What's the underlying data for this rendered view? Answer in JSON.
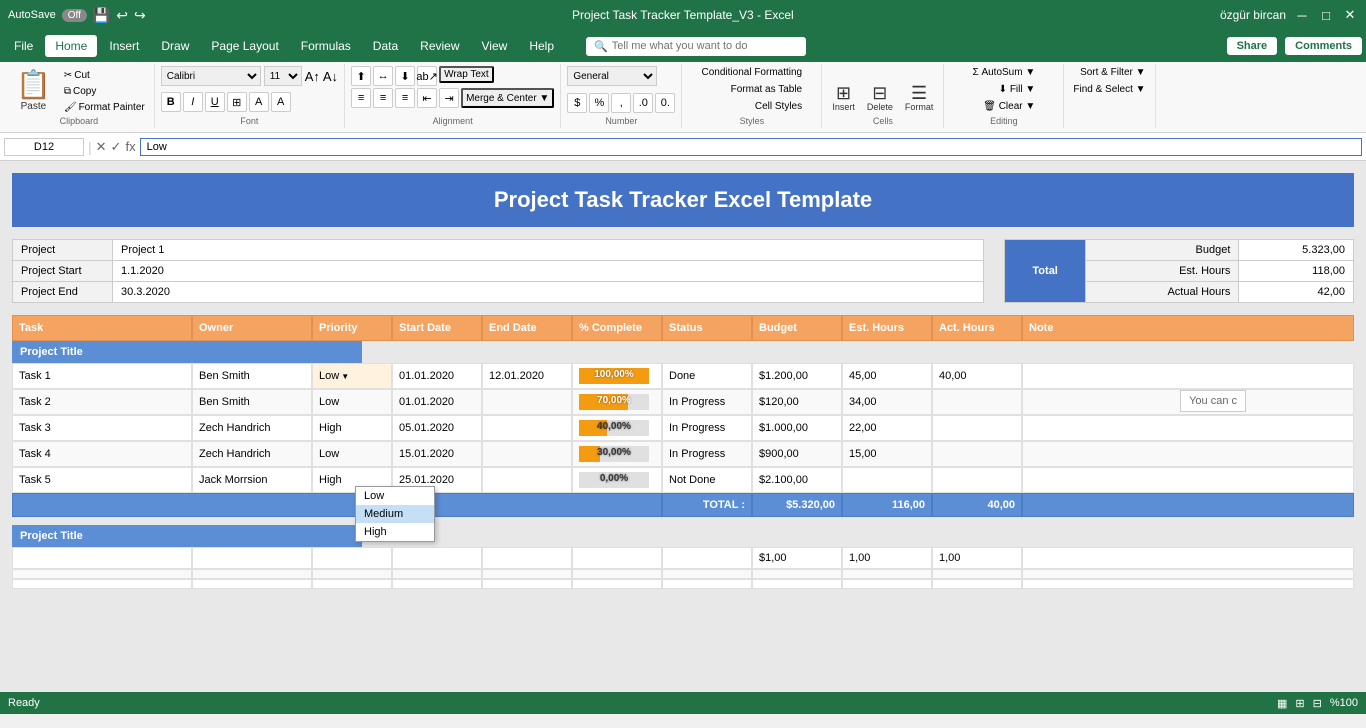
{
  "titleBar": {
    "autosave": "AutoSave",
    "autosave_off": "Off",
    "title": "Project Task Tracker Template_V3 - Excel",
    "user": "özgür bircan"
  },
  "menuBar": {
    "items": [
      "File",
      "Home",
      "Insert",
      "Draw",
      "Page Layout",
      "Formulas",
      "Data",
      "Review",
      "View",
      "Help"
    ],
    "active": "Home",
    "search_placeholder": "Tell me what you want to do",
    "share": "Share",
    "comments": "Comments"
  },
  "ribbon": {
    "clipboard": {
      "label": "Clipboard",
      "paste": "Paste",
      "cut": "Cut",
      "copy": "Copy",
      "format_painter": "Format Painter"
    },
    "font": {
      "label": "Font",
      "name": "Calibri",
      "size": "11",
      "bold": "B",
      "italic": "I",
      "underline": "U"
    },
    "alignment": {
      "label": "Alignment",
      "wrap_text": "Wrap Text",
      "merge_center": "Merge & Center"
    },
    "number": {
      "label": "Number",
      "format": "General",
      "percent": "%",
      "comma": ","
    },
    "styles": {
      "label": "Styles",
      "conditional": "Conditional Formatting",
      "format_table": "Format as Table",
      "cell_styles": "Cell Styles"
    },
    "cells": {
      "label": "Cells",
      "insert": "Insert",
      "delete": "Delete",
      "format": "Format"
    },
    "editing": {
      "label": "Editing",
      "autosum": "AutoSum",
      "fill": "Fill",
      "clear": "Clear",
      "sort_filter": "Sort & Filter",
      "find_select": "Find & Select"
    }
  },
  "formulaBar": {
    "cellRef": "D12",
    "formula": "Low"
  },
  "spreadsheet": {
    "title": "Project Task Tracker Excel Template",
    "project": {
      "name_label": "Project",
      "name_value": "Project 1",
      "start_label": "Project Start",
      "start_value": "1.1.2020",
      "end_label": "Project End",
      "end_value": "30.3.2020"
    },
    "budget": {
      "total_label": "Total",
      "budget_label": "Budget",
      "budget_value": "5.323,00",
      "est_hours_label": "Est. Hours",
      "est_hours_value": "118,00",
      "actual_hours_label": "Actual Hours",
      "actual_hours_value": "42,00"
    },
    "taskHeaders": [
      "Task",
      "Owner",
      "Priority",
      "Start Date",
      "End Date",
      "% Complete",
      "Status",
      "Budget",
      "Est. Hours",
      "Act. Hours",
      "Note"
    ],
    "project1": {
      "title": "Project Title",
      "tasks": [
        {
          "task": "Task 1",
          "owner": "Ben Smith",
          "priority": "Low",
          "start": "01.01.2020",
          "end": "12.01.2020",
          "pct": 100,
          "pct_label": "100,00%",
          "status": "Done",
          "budget": "$1.200,00",
          "est_hours": "45,00",
          "act_hours": "40,00",
          "note": "",
          "bar_color": "#f39c12"
        },
        {
          "task": "Task 2",
          "owner": "Ben Smith",
          "priority": "Low",
          "start": "01.01.2020",
          "end": "",
          "pct": 70,
          "pct_label": "70,00%",
          "status": "In Progress",
          "budget": "$120,00",
          "est_hours": "34,00",
          "act_hours": "",
          "note": "",
          "bar_color": "#f39c12"
        },
        {
          "task": "Task 3",
          "owner": "Zech Handrich",
          "priority": "High",
          "start": "05.01.2020",
          "end": "",
          "pct": 40,
          "pct_label": "40,00%",
          "status": "In Progress",
          "budget": "$1.000,00",
          "est_hours": "22,00",
          "act_hours": "",
          "note": "",
          "bar_color": "#f39c12"
        },
        {
          "task": "Task 4",
          "owner": "Zech Handrich",
          "priority": "Low",
          "start": "15.01.2020",
          "end": "",
          "pct": 30,
          "pct_label": "30,00%",
          "status": "In Progress",
          "budget": "$900,00",
          "est_hours": "15,00",
          "act_hours": "",
          "note": "",
          "bar_color": "#f39c12"
        },
        {
          "task": "Task 5",
          "owner": "Jack Morrsion",
          "priority": "High",
          "start": "25.01.2020",
          "end": "",
          "pct": 0,
          "pct_label": "0,00%",
          "status": "Not Done",
          "budget": "$2.100,00",
          "est_hours": "",
          "act_hours": "",
          "note": "",
          "bar_color": "#f39c12"
        }
      ],
      "total": {
        "label": "TOTAL :",
        "budget": "$5.320,00",
        "est_hours": "116,00",
        "act_hours": "40,00"
      }
    },
    "project2": {
      "title": "Project Title",
      "empty_row": {
        "budget": "$1,00",
        "est_hours": "1,00",
        "act_hours": "1,00"
      }
    },
    "dropdown": {
      "items": [
        "Low",
        "Medium",
        "High"
      ],
      "selected": "Medium"
    },
    "youCanNote": "You can c"
  },
  "statusBar": {
    "ready": "Ready",
    "zoom": "%100"
  }
}
